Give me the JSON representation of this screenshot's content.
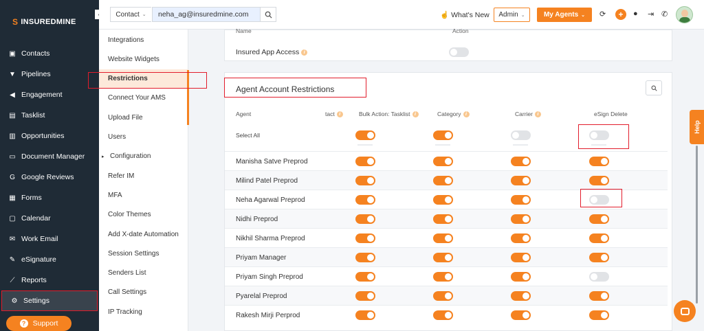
{
  "brand": {
    "name": "INSUREDMINE",
    "accent": "#f58220"
  },
  "sidebar": {
    "items": [
      {
        "label": "Contacts",
        "icon": "contacts-icon",
        "glyph": "▣"
      },
      {
        "label": "Pipelines",
        "icon": "pipelines-icon",
        "glyph": "▼"
      },
      {
        "label": "Engagement",
        "icon": "megaphone-icon",
        "glyph": "◀"
      },
      {
        "label": "Tasklist",
        "icon": "tasklist-icon",
        "glyph": "▤"
      },
      {
        "label": "Opportunities",
        "icon": "bar-chart-icon",
        "glyph": "▥"
      },
      {
        "label": "Document Manager",
        "icon": "folder-icon",
        "glyph": "▭"
      },
      {
        "label": "Google Reviews",
        "icon": "google-icon",
        "glyph": "G"
      },
      {
        "label": "Forms",
        "icon": "forms-icon",
        "glyph": "▦"
      },
      {
        "label": "Calendar",
        "icon": "calendar-icon",
        "glyph": "▢"
      },
      {
        "label": "Work Email",
        "icon": "email-icon",
        "glyph": "✉"
      },
      {
        "label": "eSignature",
        "icon": "signature-icon",
        "glyph": "✎"
      },
      {
        "label": "Reports",
        "icon": "reports-icon",
        "glyph": "⟋"
      },
      {
        "label": "Settings",
        "icon": "gear-icon",
        "glyph": "⚙"
      }
    ],
    "active": "Settings",
    "support_label": "Support"
  },
  "header": {
    "search_type": "Contact",
    "search_value": "neha_ag@insuredmine.com",
    "whats_new": "What's New",
    "role": "Admin",
    "my_agents": "My Agents"
  },
  "submenu": {
    "items": [
      "Integrations",
      "Website Widgets",
      "Restrictions",
      "Connect Your AMS",
      "Upload File",
      "Users",
      "Configuration",
      "Refer IM",
      "MFA",
      "Color Themes",
      "Add X-date Automation",
      "Session Settings",
      "Senders List",
      "Call Settings",
      "IP Tracking"
    ],
    "active": "Restrictions"
  },
  "insured_card": {
    "col_name": "Name",
    "col_action": "Action",
    "row_label": "Insured App Access",
    "row_enabled": false
  },
  "agent_card": {
    "title": "Agent Account Restrictions",
    "columns": [
      "Agent",
      "tact",
      "Bulk Action: Tasklist",
      "Category",
      "Carrier",
      "eSign Delete"
    ],
    "select_all_label": "Select All",
    "select_all": [
      true,
      true,
      false,
      false
    ],
    "rows": [
      {
        "name": "Manisha Satve Preprod",
        "toggles": [
          true,
          true,
          true,
          true
        ]
      },
      {
        "name": "Milind Patel Preprod",
        "toggles": [
          true,
          true,
          true,
          true
        ]
      },
      {
        "name": "Neha Agarwal Preprod",
        "toggles": [
          true,
          true,
          true,
          false
        ]
      },
      {
        "name": "Nidhi Preprod",
        "toggles": [
          true,
          true,
          true,
          true
        ]
      },
      {
        "name": "Nikhil Sharma Preprod",
        "toggles": [
          true,
          true,
          true,
          true
        ]
      },
      {
        "name": "Priyam Manager",
        "toggles": [
          true,
          true,
          true,
          true
        ]
      },
      {
        "name": "Priyam Singh Preprod",
        "toggles": [
          true,
          true,
          true,
          false
        ]
      },
      {
        "name": "Pyarelal Preprod",
        "toggles": [
          true,
          true,
          true,
          true
        ]
      },
      {
        "name": "Rakesh Mirji Perprod",
        "toggles": [
          true,
          true,
          true,
          true
        ]
      }
    ]
  },
  "help_label": "Help"
}
